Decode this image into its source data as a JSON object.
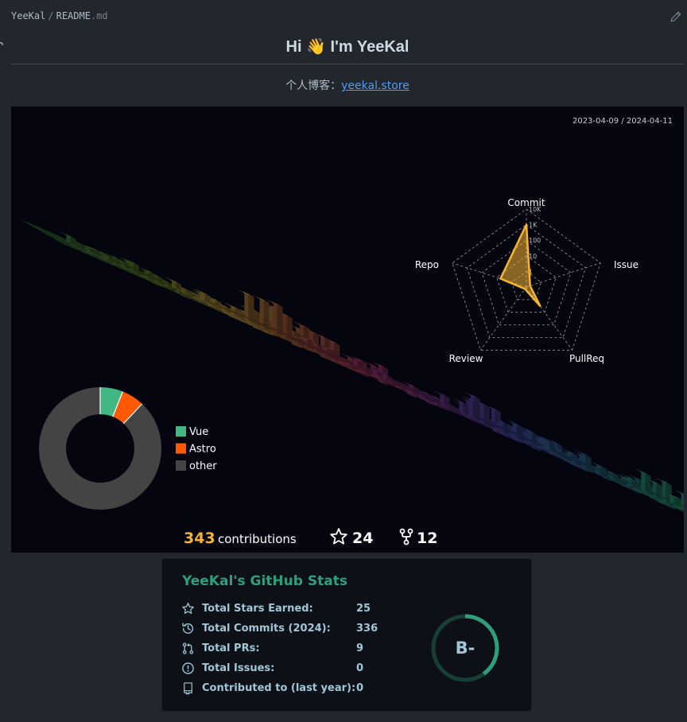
{
  "breadcrumb": {
    "repo": "YeeKal",
    "separator": "/",
    "file": "README",
    "ext": ".md"
  },
  "heading": {
    "text_before": "Hi ",
    "emoji": "👋",
    "text_after": " I'm YeeKal"
  },
  "blog": {
    "label": "个人博客：",
    "link_text": "yeekal.store"
  },
  "profile_3d": {
    "date_range": "2023-04-09 / 2024-04-11",
    "radar": {
      "axes": [
        "Commit",
        "Issue",
        "PullReq",
        "Review",
        "Repo"
      ],
      "scale_labels": [
        "10K",
        "1K",
        "100",
        "10",
        "1"
      ],
      "values": [
        0.8,
        0.05,
        0.3,
        0.0,
        0.35
      ],
      "color": "#f5b433"
    },
    "languages": [
      {
        "name": "Vue",
        "fraction": 0.06,
        "color": "#41b883"
      },
      {
        "name": "Astro",
        "fraction": 0.06,
        "color": "#ff5a03"
      },
      {
        "name": "other",
        "fraction": 0.88,
        "color": "#444444"
      }
    ],
    "contributions_count": "343",
    "contributions_label": "contributions",
    "stars": "24",
    "forks": "12"
  },
  "stats": {
    "title": "YeeKal's GitHub Stats",
    "rows": [
      {
        "icon": "star-icon",
        "label": "Total Stars Earned:",
        "value": "25"
      },
      {
        "icon": "history-icon",
        "label": "Total Commits (2024):",
        "value": "336"
      },
      {
        "icon": "pull-request-icon",
        "label": "Total PRs:",
        "value": "9"
      },
      {
        "icon": "issue-icon",
        "label": "Total Issues:",
        "value": "0"
      },
      {
        "icon": "repo-icon",
        "label": "Contributed to (last year):",
        "value": "0"
      }
    ],
    "rank": "B-",
    "rank_progress": 0.4,
    "colors": {
      "title": "#2f9e7b",
      "text": "#9fc7d7",
      "ring": "#2f9e7b"
    }
  }
}
